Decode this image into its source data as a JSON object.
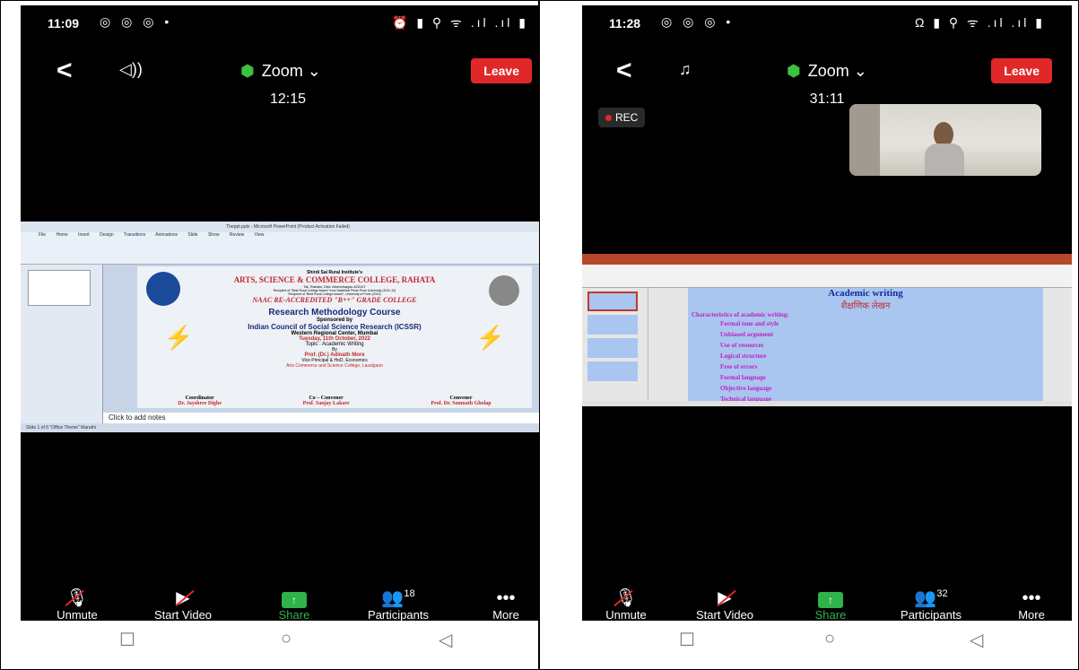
{
  "left": {
    "status": {
      "time": "11:09",
      "left_icons": "◎ ◎ ◎ •",
      "right_icons": "⏰ ▮ ⚲ ᯤ .ıl .ıl ▮"
    },
    "meeting": {
      "back": "<",
      "name": "Zoom",
      "leave": "Leave",
      "timer": "12:15"
    },
    "ppt": {
      "window_title": "Theppt.pptx - Microsoft PowerPoint (Product Activation Failed)",
      "tabs": "File Home Insert Design Transitions Animations Slide Show Review View",
      "notes": "Click to add notes",
      "statusbar": "Slide 1 of 6   \"Office Theme\"   Marathi"
    },
    "slide": {
      "institute": "Shirdi Sai Rural Institute's",
      "college": "ARTS, SCIENCE & COMMERCE COLLEGE, RAHATA",
      "address": "Tal- Rahata, Dist- Ahmednagar-423107",
      "award1": "Recipient of \"Best Rural College Award\" from Savitribai Phule Pune University (2011-12)",
      "award2": "Recipient of \"Best Rural College Award\", University of Pune (2013)",
      "naac": "NAAC RE-ACCREDITED \"B++\" GRADE COLLEGE",
      "course": "Research Methodology Course",
      "sponsored": "Sponsored by",
      "council": "Indian Council of Social Science Research (ICSSR)",
      "center": "Western Regional Center, Mumbai",
      "date": "Tuesday, 11th October, 2022",
      "topic": "Topic : Academic Writing",
      "by": "By",
      "speaker": "Prof. (Dr.) Adinath More",
      "role": "Vice Principal & HoD, Economics",
      "speaker_college": "Arts Commerce and Science College, Lasalgaon",
      "coordinator_label": "Coordinator",
      "coordinator": "Dr. Jayshree Dighe",
      "coconvener_label": "Co – Convener",
      "coconvener": "Prof. Sanjay Lakare",
      "convener_label": "Convener",
      "convener": "Prof. Dr. Somnath Gholap"
    },
    "toolbar": {
      "unmute": "Unmute",
      "start_video": "Start Video",
      "share": "Share",
      "participants": "Participants",
      "participants_count": "18",
      "more": "More"
    }
  },
  "right": {
    "status": {
      "time": "11:28",
      "left_icons": "◎ ◎ ◎ •",
      "right_icons": "Ω ▮ ⚲ ᯤ .ıl .ıl ▮"
    },
    "meeting": {
      "back": "<",
      "name": "Zoom",
      "leave": "Leave",
      "timer": "31:11",
      "rec": "REC"
    },
    "slide": {
      "title": "Academic writing",
      "subtitle": "शैक्षणिक लेखन",
      "heading": "Characteristics of academic writing:",
      "items": [
        "Formal tone and style",
        "Unbiased argument",
        "Use of resources",
        "Logical structure",
        "Free of errors",
        "Formal language",
        "Objective language",
        "Technical language"
      ]
    },
    "toolbar": {
      "unmute": "Unmute",
      "start_video": "Start Video",
      "share": "Share",
      "participants": "Participants",
      "participants_count": "32",
      "more": "More"
    }
  },
  "nav": {
    "recents": "☐",
    "home": "○",
    "back": "◁"
  },
  "colors": {
    "leave": "#e02828",
    "share": "#2fb34a",
    "shield": "#3cc23c",
    "slide_red": "#c0282d",
    "slide_magenta": "#c020c0"
  }
}
